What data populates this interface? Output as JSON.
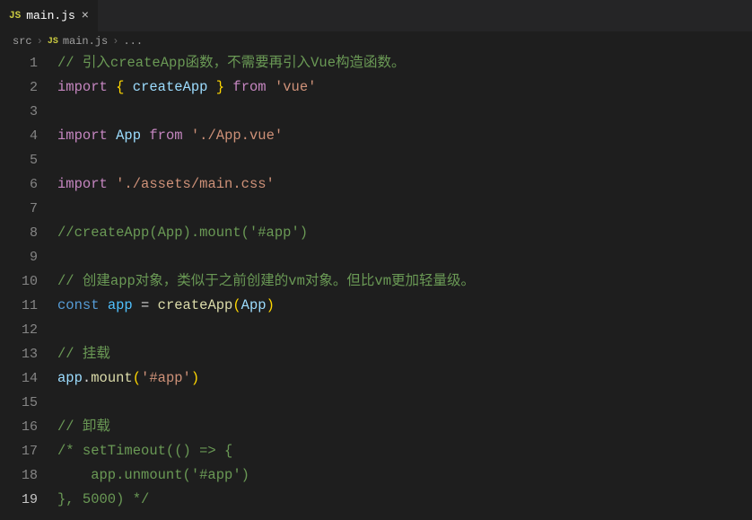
{
  "tab": {
    "iconText": "JS",
    "filename": "main.js"
  },
  "breadcrumb": {
    "icon": "JS",
    "parts": [
      "src",
      "main.js",
      "..."
    ]
  },
  "code": {
    "lines": [
      [
        {
          "c": "tk-comment",
          "t": "// 引入createApp函数，不需要再引入Vue构造函数。"
        }
      ],
      [
        {
          "c": "tk-keyword",
          "t": "import"
        },
        {
          "c": "tk-punct",
          "t": " "
        },
        {
          "c": "tk-brace-y",
          "t": "{"
        },
        {
          "c": "tk-punct",
          "t": " "
        },
        {
          "c": "tk-var",
          "t": "createApp"
        },
        {
          "c": "tk-punct",
          "t": " "
        },
        {
          "c": "tk-brace-y",
          "t": "}"
        },
        {
          "c": "tk-punct",
          "t": " "
        },
        {
          "c": "tk-keyword",
          "t": "from"
        },
        {
          "c": "tk-punct",
          "t": " "
        },
        {
          "c": "tk-string",
          "t": "'vue'"
        }
      ],
      [],
      [
        {
          "c": "tk-keyword",
          "t": "import"
        },
        {
          "c": "tk-punct",
          "t": " "
        },
        {
          "c": "tk-var",
          "t": "App"
        },
        {
          "c": "tk-punct",
          "t": " "
        },
        {
          "c": "tk-keyword",
          "t": "from"
        },
        {
          "c": "tk-punct",
          "t": " "
        },
        {
          "c": "tk-string",
          "t": "'./App.vue'"
        }
      ],
      [],
      [
        {
          "c": "tk-keyword",
          "t": "import"
        },
        {
          "c": "tk-punct",
          "t": " "
        },
        {
          "c": "tk-string",
          "t": "'./assets/main.css'"
        }
      ],
      [],
      [
        {
          "c": "tk-comment",
          "t": "//createApp(App).mount('#app')"
        }
      ],
      [],
      [
        {
          "c": "tk-comment",
          "t": "// 创建app对象，类似于之前创建的vm对象。但比vm更加轻量级。"
        }
      ],
      [
        {
          "c": "tk-storage",
          "t": "const"
        },
        {
          "c": "tk-punct",
          "t": " "
        },
        {
          "c": "tk-const",
          "t": "app"
        },
        {
          "c": "tk-punct",
          "t": " = "
        },
        {
          "c": "tk-func",
          "t": "createApp"
        },
        {
          "c": "tk-brace-y",
          "t": "("
        },
        {
          "c": "tk-var",
          "t": "App"
        },
        {
          "c": "tk-brace-y",
          "t": ")"
        }
      ],
      [],
      [
        {
          "c": "tk-comment",
          "t": "// 挂载"
        }
      ],
      [
        {
          "c": "tk-var",
          "t": "app"
        },
        {
          "c": "tk-punct",
          "t": "."
        },
        {
          "c": "tk-func",
          "t": "mount"
        },
        {
          "c": "tk-brace-y",
          "t": "("
        },
        {
          "c": "tk-string",
          "t": "'#app'"
        },
        {
          "c": "tk-brace-y",
          "t": ")"
        }
      ],
      [],
      [
        {
          "c": "tk-comment",
          "t": "// 卸载"
        }
      ],
      [
        {
          "c": "tk-comment",
          "t": "/* setTimeout(() => {"
        }
      ],
      [
        {
          "c": "tk-comment",
          "t": "    app.unmount('#app')"
        }
      ],
      [
        {
          "c": "tk-comment",
          "t": "}, 5000) */"
        }
      ]
    ],
    "activeLine": 19
  }
}
